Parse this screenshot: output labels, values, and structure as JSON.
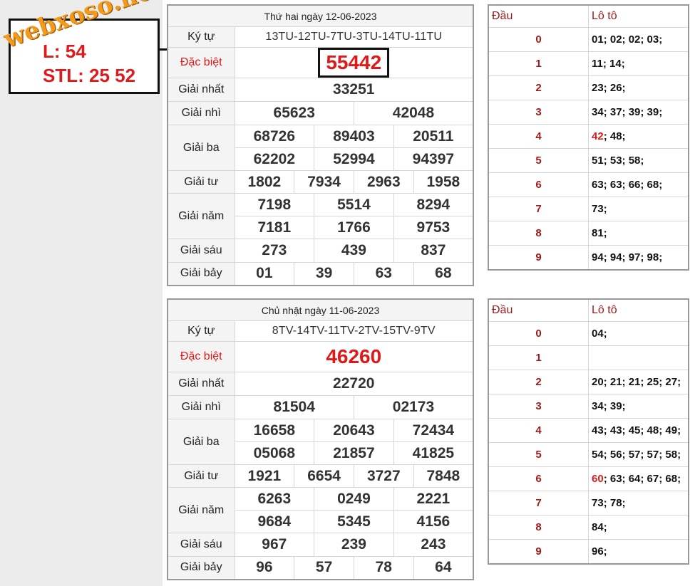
{
  "sidebar": {
    "watermark": "webxoso.net",
    "stl_line1": "L: 54",
    "stl_line2": "STL: 25 52"
  },
  "results": [
    {
      "title": "Thứ hai ngày 12-06-2023",
      "labels": {
        "code": "Ký tự",
        "special": "Đặc biệt",
        "first": "Giải nhất",
        "second": "Giải nhì",
        "third": "Giải ba",
        "fourth": "Giải tư",
        "fifth": "Giải năm",
        "sixth": "Giải sáu",
        "seventh": "Giải bảy"
      },
      "code": "13TU-12TU-7TU-3TU-14TU-11TU",
      "special": "55442",
      "first": "33251",
      "second": [
        "65623",
        "42048"
      ],
      "third": [
        "68726",
        "89403",
        "20511",
        "62202",
        "52994",
        "94397"
      ],
      "fourth": [
        "1802",
        "7934",
        "2963",
        "1958"
      ],
      "fifth": [
        "7198",
        "5514",
        "8294",
        "7181",
        "1766",
        "9753"
      ],
      "sixth": [
        "273",
        "439",
        "837"
      ],
      "seventh": [
        "01",
        "39",
        "63",
        "68"
      ]
    },
    {
      "title": "Chủ nhật ngày 11-06-2023",
      "labels": {
        "code": "Ký tự",
        "special": "Đặc biệt",
        "first": "Giải nhất",
        "second": "Giải nhì",
        "third": "Giải ba",
        "fourth": "Giải tư",
        "fifth": "Giải năm",
        "sixth": "Giải sáu",
        "seventh": "Giải bảy"
      },
      "code": "8TV-14TV-11TV-2TV-15TV-9TV",
      "special": "46260",
      "first": "22720",
      "second": [
        "81504",
        "02173"
      ],
      "third": [
        "16658",
        "20643",
        "72434",
        "05068",
        "21857",
        "41825"
      ],
      "fourth": [
        "1921",
        "6654",
        "3727",
        "7848"
      ],
      "fifth": [
        "6263",
        "0249",
        "2221",
        "9684",
        "5345",
        "4156"
      ],
      "sixth": [
        "967",
        "239",
        "243"
      ],
      "seventh": [
        "96",
        "57",
        "78",
        "64"
      ]
    }
  ],
  "loto": [
    {
      "head_label": "Đầu",
      "values_label": "Lô tô",
      "rows": [
        {
          "d": "0",
          "pre": "",
          "hl": "",
          "post": "01; 02; 02; 03;"
        },
        {
          "d": "1",
          "pre": "",
          "hl": "",
          "post": "11; 14;"
        },
        {
          "d": "2",
          "pre": "",
          "hl": "",
          "post": "23; 26;"
        },
        {
          "d": "3",
          "pre": "",
          "hl": "",
          "post": "34; 37; 39; 39;"
        },
        {
          "d": "4",
          "pre": "",
          "hl": "42",
          "post": "; 48;"
        },
        {
          "d": "5",
          "pre": "",
          "hl": "",
          "post": "51; 53; 58;"
        },
        {
          "d": "6",
          "pre": "",
          "hl": "",
          "post": "63; 63; 66; 68;"
        },
        {
          "d": "7",
          "pre": "",
          "hl": "",
          "post": "73;"
        },
        {
          "d": "8",
          "pre": "",
          "hl": "",
          "post": "81;"
        },
        {
          "d": "9",
          "pre": "",
          "hl": "",
          "post": "94; 94; 97; 98;"
        }
      ]
    },
    {
      "head_label": "Đầu",
      "values_label": "Lô tô",
      "rows": [
        {
          "d": "0",
          "pre": "",
          "hl": "",
          "post": "04;"
        },
        {
          "d": "1",
          "pre": "",
          "hl": "",
          "post": ""
        },
        {
          "d": "2",
          "pre": "",
          "hl": "",
          "post": "20; 21; 21; 25; 27;"
        },
        {
          "d": "3",
          "pre": "",
          "hl": "",
          "post": "34; 39;"
        },
        {
          "d": "4",
          "pre": "",
          "hl": "",
          "post": "43; 43; 45; 48; 49;"
        },
        {
          "d": "5",
          "pre": "",
          "hl": "",
          "post": "54; 56; 57; 57; 58;"
        },
        {
          "d": "6",
          "pre": "",
          "hl": "60",
          "post": "; 63; 64; 67; 68;"
        },
        {
          "d": "7",
          "pre": "",
          "hl": "",
          "post": "73; 78;"
        },
        {
          "d": "8",
          "pre": "",
          "hl": "",
          "post": "84;"
        },
        {
          "d": "9",
          "pre": "",
          "hl": "",
          "post": "96;"
        }
      ]
    }
  ],
  "colors": {
    "special": "#e01a1a",
    "label_red": "#e01a1a",
    "watermark": "#f39a1a",
    "loto_head": "#a11a1a"
  }
}
